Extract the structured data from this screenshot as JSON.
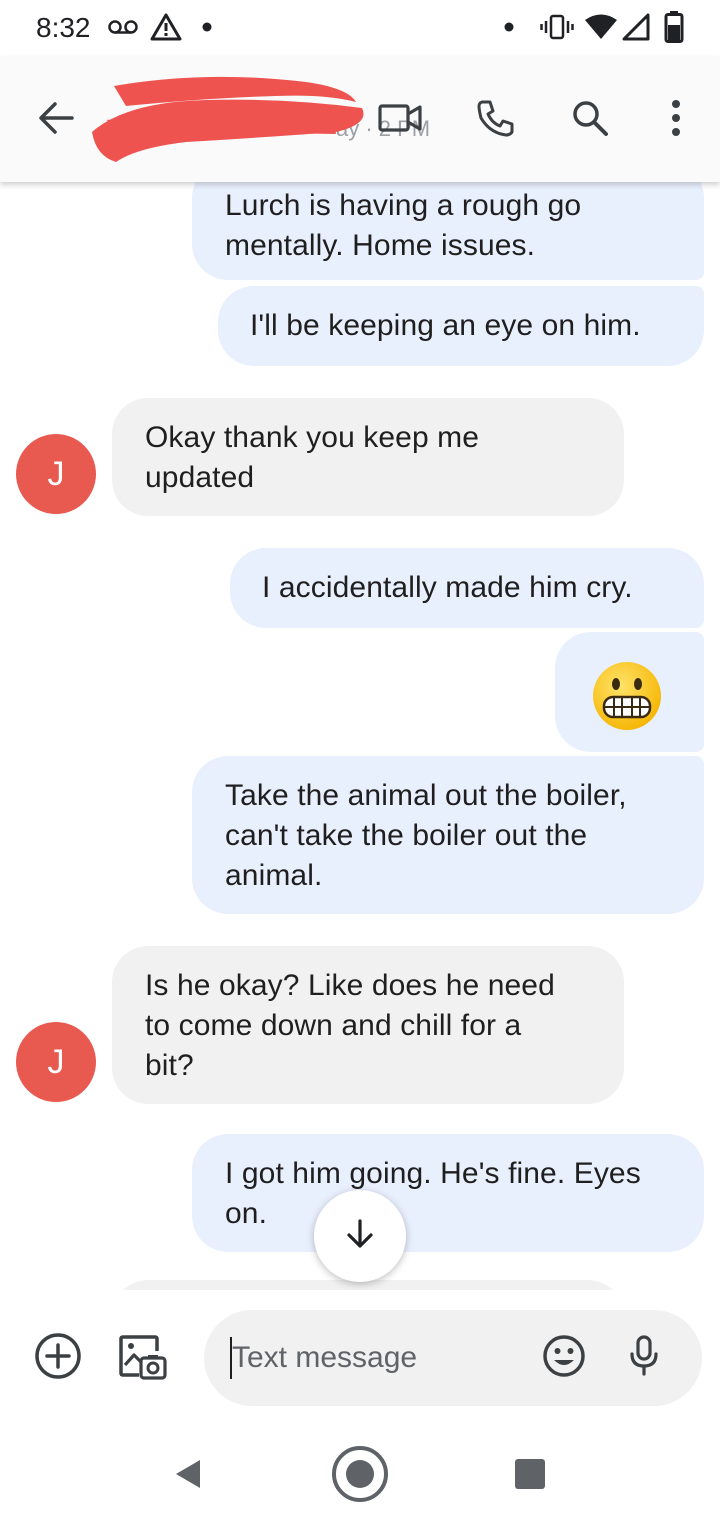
{
  "status_bar": {
    "time": "8:32",
    "icons": [
      "voicemail-icon",
      "warning-icon",
      "dot-icon",
      "dot-icon",
      "vibrate-icon",
      "wifi-icon",
      "signal-icon",
      "battery-icon"
    ]
  },
  "header": {
    "back_icon": "arrow-left-icon",
    "contact_name_redacted": true,
    "redaction_color": "#ef5350",
    "contact_subtitle_fragment": "ay · 2 PM",
    "actions": [
      "video-call-icon",
      "phone-icon",
      "search-icon",
      "more-vert-icon"
    ]
  },
  "messages": [
    {
      "direction": "outgoing",
      "text_lines": [
        "Lurch is having a rough go",
        "mentally. Home issues."
      ]
    },
    {
      "direction": "outgoing",
      "text_lines": [
        "I'll be keeping an eye on him."
      ]
    },
    {
      "direction": "incoming",
      "avatar": "J",
      "text_lines": [
        "Okay thank you keep me",
        "updated"
      ]
    },
    {
      "direction": "outgoing",
      "text_lines": [
        "I accidentally made him cry."
      ]
    },
    {
      "direction": "outgoing",
      "emoji": "grimacing-face-emoji"
    },
    {
      "direction": "outgoing",
      "text_lines": [
        "Take the animal out the boiler,",
        "can't take the boiler out the",
        "animal."
      ]
    },
    {
      "direction": "incoming",
      "avatar": "J",
      "text_lines": [
        "Is he okay? Like does he need",
        "to come down and chill for a",
        "bit?"
      ]
    },
    {
      "direction": "outgoing",
      "text_lines": [
        "I got him going. He's fine. Eyes",
        "on."
      ]
    }
  ],
  "scroll_down_icon": "arrow-down-icon",
  "compose": {
    "placeholder": "Text message",
    "value": "",
    "left_icons": [
      "add-circle-icon",
      "gallery-icon"
    ],
    "right_icons": [
      "emoji-icon",
      "mic-icon"
    ]
  },
  "nav_bar": [
    "back-triangle-icon",
    "home-circle-icon",
    "recents-square-icon"
  ],
  "colors": {
    "outgoing_bubble": "#e8effd",
    "incoming_bubble": "#f1f1f1",
    "avatar": "#e8594f",
    "icon": "#3c4043"
  }
}
